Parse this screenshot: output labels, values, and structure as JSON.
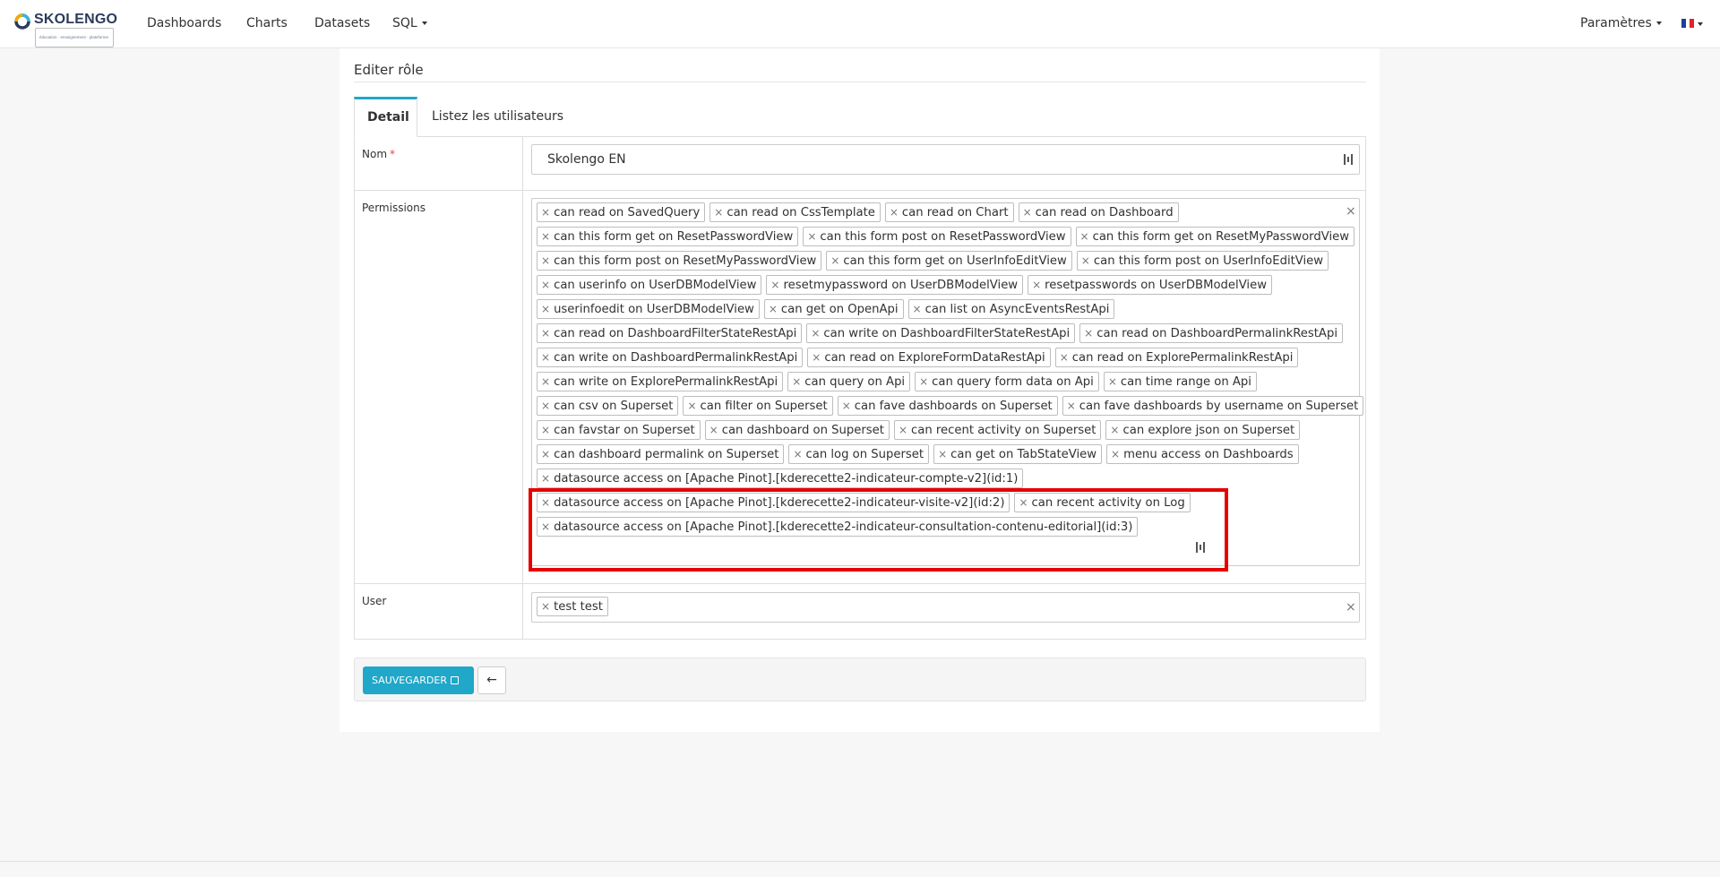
{
  "brand": {
    "name": "SKOLENGO",
    "tagline": "éducation · enseignement · plateforme"
  },
  "nav": {
    "items": [
      "Dashboards",
      "Charts",
      "Datasets",
      "SQL"
    ],
    "settings": "Paramètres",
    "language_flag": "fr"
  },
  "page": {
    "title": "Editer rôle",
    "tabs": [
      "Detail",
      "Listez les utilisateurs"
    ]
  },
  "form": {
    "name_label": "Nom",
    "required_mark": "*",
    "name_value": "Skolengo EN",
    "permissions_label": "Permissions",
    "clear_symbol": "×",
    "permissions": [
      "can read on SavedQuery",
      "can read on CssTemplate",
      "can read on Chart",
      "can read on Dashboard",
      "can this form get on ResetPasswordView",
      "can this form post on ResetPasswordView",
      "can this form get on ResetMyPasswordView",
      "can this form post on ResetMyPasswordView",
      "can this form get on UserInfoEditView",
      "can this form post on UserInfoEditView",
      "can userinfo on UserDBModelView",
      "resetmypassword on UserDBModelView",
      "resetpasswords on UserDBModelView",
      "userinfoedit on UserDBModelView",
      "can get on OpenApi",
      "can list on AsyncEventsRestApi",
      "can read on DashboardFilterStateRestApi",
      "can write on DashboardFilterStateRestApi",
      "can read on DashboardPermalinkRestApi",
      "can write on DashboardPermalinkRestApi",
      "can read on ExploreFormDataRestApi",
      "can read on ExplorePermalinkRestApi",
      "can write on ExplorePermalinkRestApi",
      "can query on Api",
      "can query form data on Api",
      "can time range on Api",
      "can csv on Superset",
      "can filter on Superset",
      "can fave dashboards on Superset",
      "can fave dashboards by username on Superset",
      "can favstar on Superset",
      "can dashboard on Superset",
      "can recent activity on Superset",
      "can explore json on Superset",
      "can dashboard permalink on Superset",
      "can log on Superset",
      "can get on TabStateView",
      "menu access on Dashboards",
      "datasource access on [Apache Pinot].[kderecette2-indicateur-compte-v2](id:1)",
      "datasource access on [Apache Pinot].[kderecette2-indicateur-visite-v2](id:2)",
      "can recent activity on Log",
      "datasource access on [Apache Pinot].[kderecette2-indicateur-consultation-contenu-editorial](id:3)"
    ],
    "user_label": "User",
    "users": [
      "test test"
    ]
  },
  "actions": {
    "save_label": "SAUVEGARDER",
    "back_symbol": "←"
  },
  "colors": {
    "accent": "#20a7c9",
    "highlight_box": "#e60000",
    "required": "#e04355"
  }
}
